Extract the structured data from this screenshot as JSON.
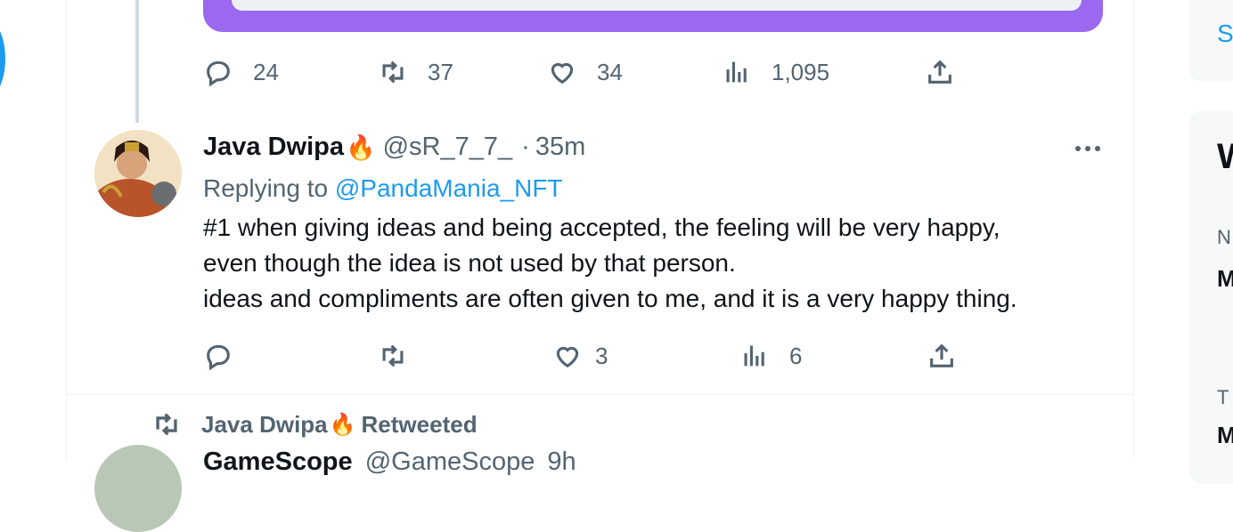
{
  "prev_tweet": {
    "actions": {
      "replies": "24",
      "retweets": "37",
      "likes": "34",
      "views": "1,095"
    }
  },
  "tweet": {
    "author_name": "Java Dwipa",
    "author_emoji": "🔥",
    "handle": "@sR_7_7_",
    "separator": "·",
    "time": "35m",
    "replying_prefix": "Replying to",
    "replying_to": "@PandaMania_NFT",
    "text_lines": [
      "#1 when giving ideas and being accepted, the feeling will be very happy,",
      "even though the idea is not used by that person.",
      "ideas and compliments are often given to me, and it is a very happy thing."
    ],
    "actions": {
      "replies": "",
      "retweets": "",
      "likes": "3",
      "views": "6"
    }
  },
  "retweet_banner": {
    "name": "Java Dwipa",
    "emoji": "🔥",
    "label": "Retweeted"
  },
  "next_tweet": {
    "author_name": "GameScope",
    "handle": "@GameScope",
    "time": "9h"
  },
  "sidebar": {
    "top_link": "S",
    "box_title": "W",
    "items": [
      {
        "sub": "N",
        "title": "M"
      },
      {
        "sub": "T",
        "title": "M"
      }
    ]
  },
  "colors": {
    "accent": "#1d9bf0",
    "card": "#9b68f0",
    "muted": "#536471"
  }
}
